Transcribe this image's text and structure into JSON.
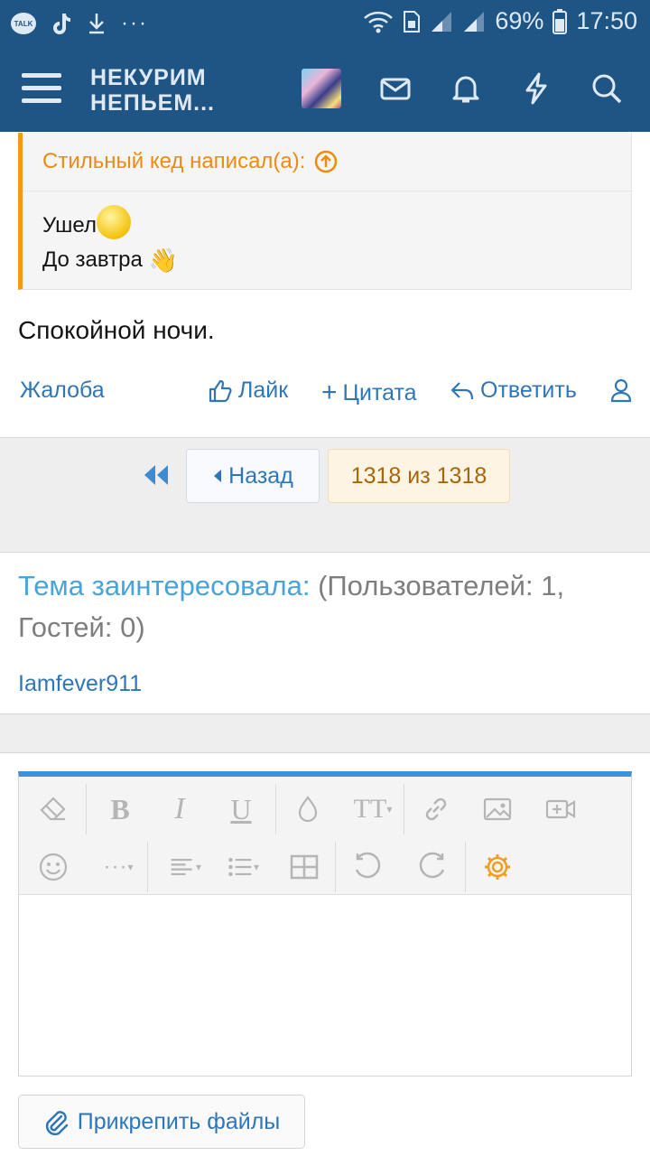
{
  "status_bar": {
    "talk_badge": "TALK",
    "battery": "69%",
    "time": "17:50"
  },
  "header": {
    "logo_line1": "НЕКУРИМ",
    "logo_line2": "НЕПЬЕМ...",
    "icons": [
      "menu-icon",
      "avatar",
      "envelope-icon",
      "bell-icon",
      "lightning-icon",
      "search-icon"
    ]
  },
  "quote": {
    "author_line": "Стильный кед написал(а):",
    "line1": "Ушел",
    "line2": "До завтра"
  },
  "post": {
    "text": "Спокойной ночи."
  },
  "actions": {
    "report": "Жалоба",
    "like": "Лайк",
    "quote": "Цитата",
    "reply": "Ответить"
  },
  "pagination": {
    "back_label": "Назад",
    "current": "1318 из 1318"
  },
  "interest": {
    "label": "Тема заинтересовала:",
    "line1_rest": " (Пользователей: 1,",
    "line2": "Гостей: 0)",
    "user": "Iamfever911"
  },
  "editor": {
    "toolbar_icons": [
      "eraser-icon",
      "bold-icon",
      "italic-icon",
      "underline-icon",
      "color-drop-icon",
      "text-size-icon",
      "link-icon",
      "image-icon",
      "video-icon",
      "smiley-icon",
      "more-icon",
      "align-icon",
      "list-icon",
      "table-icon",
      "undo-icon",
      "redo-icon",
      "settings-icon"
    ],
    "accent": "#3c93d8"
  },
  "attach": {
    "label": "Прикрепить файлы"
  },
  "colors": {
    "header_bg": "#1e5585",
    "quote_accent": "#f39a16",
    "link": "#2f76b8"
  }
}
